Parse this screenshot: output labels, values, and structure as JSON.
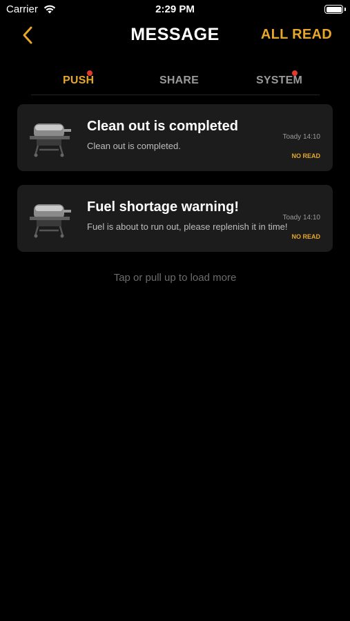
{
  "status_bar": {
    "carrier": "Carrier",
    "time": "2:29 PM"
  },
  "nav": {
    "title": "MESSAGE",
    "all_read": "ALL READ",
    "back_icon": "chevron-left-icon"
  },
  "tabs": [
    {
      "label": "PUSH",
      "active": true,
      "has_dot": true
    },
    {
      "label": "SHARE",
      "active": false,
      "has_dot": false
    },
    {
      "label": "SYSTEM",
      "active": false,
      "has_dot": true
    }
  ],
  "messages": [
    {
      "icon": "grill-icon",
      "title": "Clean out is completed",
      "body": "Clean out is completed.",
      "time": "Toady 14:10",
      "status": "NO READ"
    },
    {
      "icon": "grill-icon",
      "title": "Fuel shortage warning!",
      "body": "Fuel is about to run out, please replenish it in time!",
      "time": "Toady 14:10",
      "status": "NO READ"
    }
  ],
  "footer": {
    "load_more": "Tap or pull up to load more"
  },
  "colors": {
    "accent": "#e5a82a",
    "background": "#000000",
    "card": "#1c1c1c",
    "dot": "#e03a2f"
  }
}
